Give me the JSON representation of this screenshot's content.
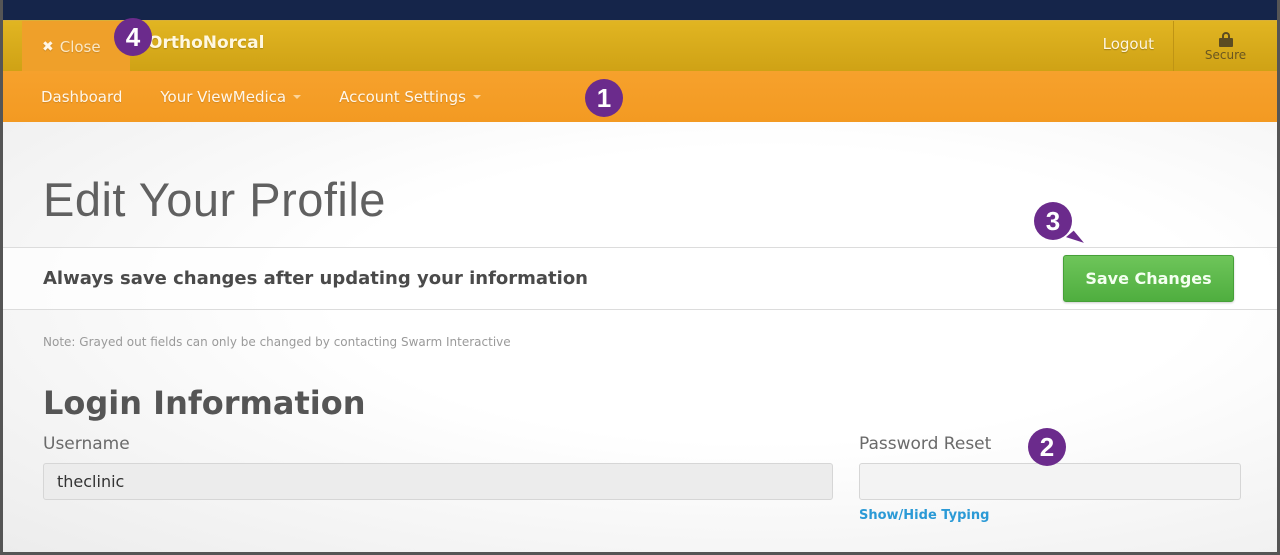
{
  "header": {
    "close_label": "Close",
    "close_icon": "x-icon",
    "brand": "OrthoNorcal",
    "logout_label": "Logout",
    "secure_label": "Secure",
    "secure_icon": "lock-icon"
  },
  "nav": {
    "items": [
      {
        "label": "Dashboard",
        "has_dropdown": false
      },
      {
        "label": "Your ViewMedica",
        "has_dropdown": true
      },
      {
        "label": "Account Settings",
        "has_dropdown": true
      }
    ]
  },
  "page": {
    "title": "Edit Your Profile",
    "save_notice": "Always save changes after updating your information",
    "save_button": "Save Changes",
    "note": "Note: Grayed out fields can only be changed by contacting Swarm Interactive",
    "section_title": "Login Information",
    "fields": {
      "username": {
        "label": "Username",
        "value": "theclinic",
        "disabled": true
      },
      "password_reset": {
        "label": "Password Reset",
        "value": "",
        "placeholder": ""
      }
    },
    "show_hide_link": "Show/Hide Typing"
  },
  "callouts": {
    "nav": "1",
    "password": "2",
    "save": "3",
    "close": "4",
    "color": "#6b2b8c"
  },
  "colors": {
    "top_strip": "#15254a",
    "brand_bar": "#d8ab1b",
    "nav_bar": "#f39a22",
    "save_button": "#5bb84a",
    "link": "#2b9ad6"
  }
}
